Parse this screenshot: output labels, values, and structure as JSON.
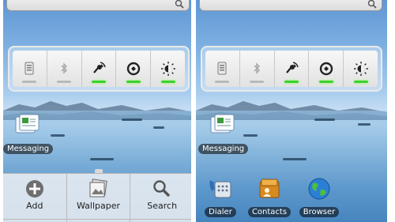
{
  "left_screen": {
    "widget_toggles": [
      {
        "icon": "wifi-icon",
        "state": "off"
      },
      {
        "icon": "bluetooth-icon",
        "state": "off"
      },
      {
        "icon": "gps-icon",
        "state": "on"
      },
      {
        "icon": "sync-icon",
        "state": "on"
      },
      {
        "icon": "brightness-icon",
        "state": "on"
      }
    ],
    "messaging_label": "Messaging",
    "menu": {
      "add_label": "Add",
      "wallpaper_label": "Wallpaper",
      "search_label": "Search"
    }
  },
  "right_screen": {
    "widget_toggles": [
      {
        "icon": "wifi-icon",
        "state": "off"
      },
      {
        "icon": "bluetooth-icon",
        "state": "off"
      },
      {
        "icon": "gps-icon",
        "state": "on"
      },
      {
        "icon": "sync-icon",
        "state": "on"
      },
      {
        "icon": "brightness-icon",
        "state": "on"
      }
    ],
    "messaging_label": "Messaging",
    "dock": {
      "dialer_label": "Dialer",
      "contacts_label": "Contacts",
      "browser_label": "Browser"
    }
  },
  "colors": {
    "toggle_on": "#3dd12c",
    "toggle_off": "#b9b9b9",
    "label_bg": "#000000"
  }
}
